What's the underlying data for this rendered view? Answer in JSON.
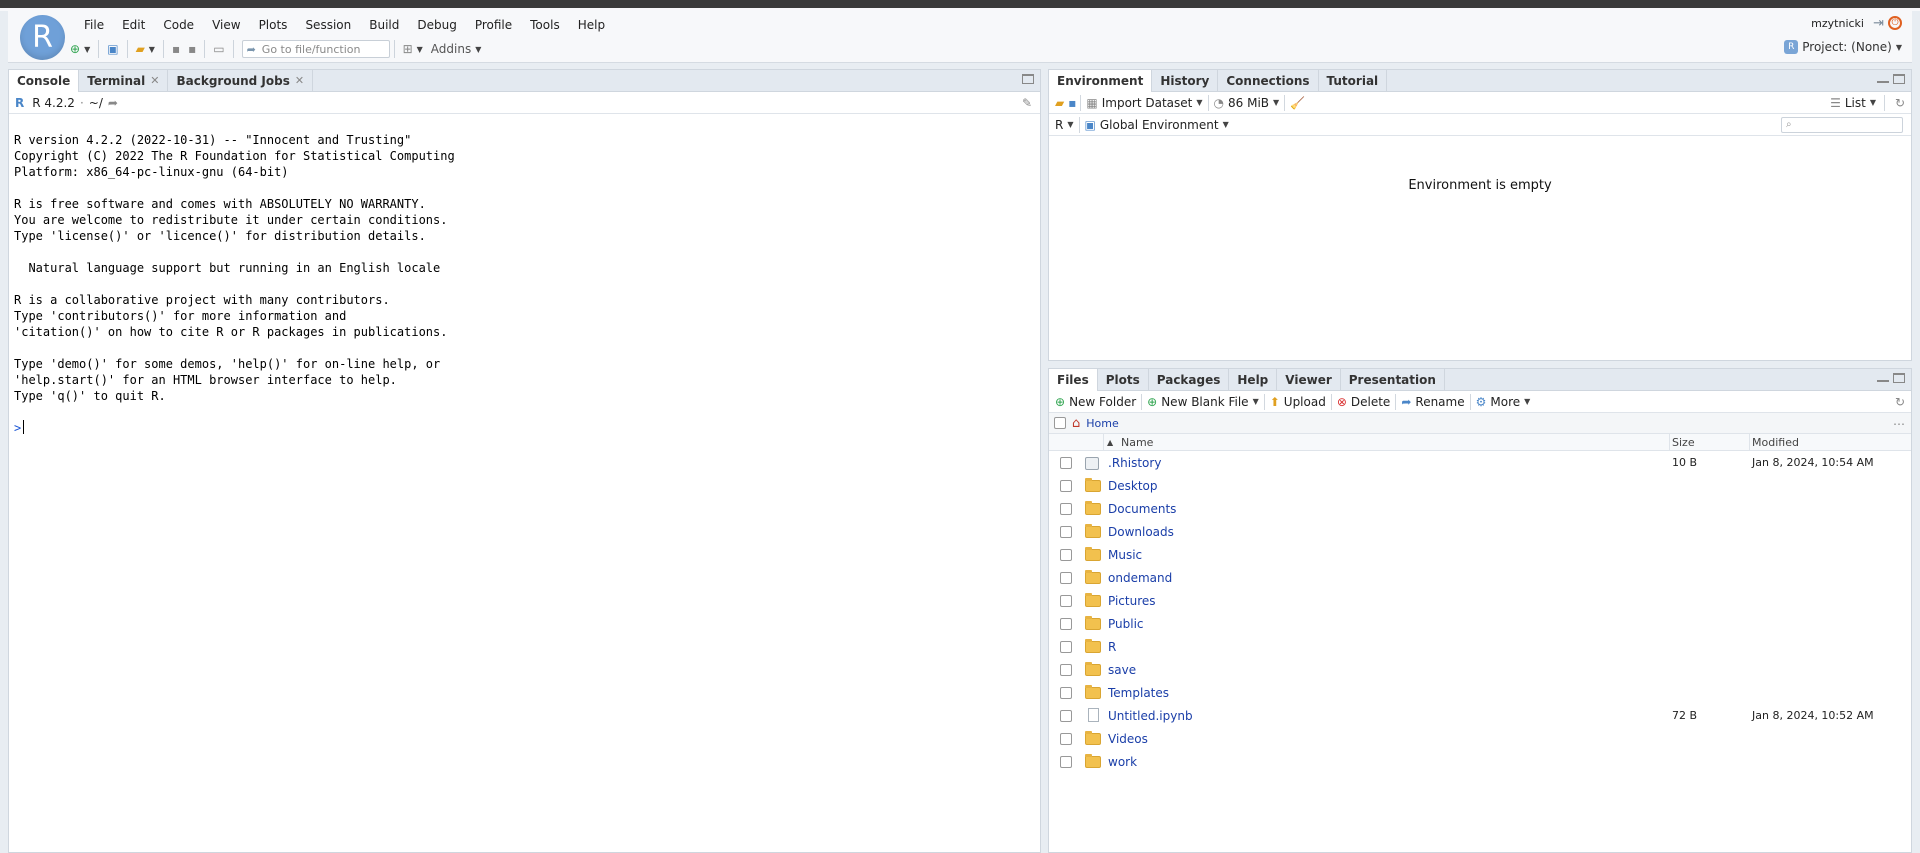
{
  "app": {
    "logo_letter": "R",
    "menus": [
      "File",
      "Edit",
      "Code",
      "View",
      "Plots",
      "Session",
      "Build",
      "Debug",
      "Profile",
      "Tools",
      "Help"
    ],
    "goto_placeholder": "Go to file/function",
    "addins_label": "Addins",
    "username": "mzytnicki",
    "project_label": "Project: (None)"
  },
  "console": {
    "tabs": [
      {
        "label": "Console",
        "closable": false
      },
      {
        "label": "Terminal",
        "closable": true
      },
      {
        "label": "Background Jobs",
        "closable": true
      }
    ],
    "version_label": "R 4.2.2",
    "path_label": "~/",
    "lines": [
      "R version 4.2.2 (2022-10-31) -- \"Innocent and Trusting\"",
      "Copyright (C) 2022 The R Foundation for Statistical Computing",
      "Platform: x86_64-pc-linux-gnu (64-bit)",
      "",
      "R is free software and comes with ABSOLUTELY NO WARRANTY.",
      "You are welcome to redistribute it under certain conditions.",
      "Type 'license()' or 'licence()' for distribution details.",
      "",
      "  Natural language support but running in an English locale",
      "",
      "R is a collaborative project with many contributors.",
      "Type 'contributors()' for more information and",
      "'citation()' on how to cite R or R packages in publications.",
      "",
      "Type 'demo()' for some demos, 'help()' for on-line help, or",
      "'help.start()' for an HTML browser interface to help.",
      "Type 'q()' to quit R.",
      ""
    ],
    "prompt": ">"
  },
  "environment": {
    "tabs": [
      "Environment",
      "History",
      "Connections",
      "Tutorial"
    ],
    "import_label": "Import Dataset",
    "memory_label": "86 MiB",
    "view_mode": "List",
    "language": "R",
    "scope": "Global Environment",
    "empty_message": "Environment is empty"
  },
  "files": {
    "tabs": [
      "Files",
      "Plots",
      "Packages",
      "Help",
      "Viewer",
      "Presentation"
    ],
    "actions": {
      "new_folder": "New Folder",
      "new_blank_file": "New Blank File",
      "upload": "Upload",
      "delete": "Delete",
      "rename": "Rename",
      "more": "More"
    },
    "breadcrumb": "Home",
    "columns": {
      "name": "Name",
      "size": "Size",
      "modified": "Modified"
    },
    "rows": [
      {
        "name": ".Rhistory",
        "type": "history",
        "size": "10 B",
        "modified": "Jan 8, 2024, 10:54 AM"
      },
      {
        "name": "Desktop",
        "type": "folder",
        "size": "",
        "modified": ""
      },
      {
        "name": "Documents",
        "type": "folder",
        "size": "",
        "modified": ""
      },
      {
        "name": "Downloads",
        "type": "folder",
        "size": "",
        "modified": ""
      },
      {
        "name": "Music",
        "type": "folder",
        "size": "",
        "modified": ""
      },
      {
        "name": "ondemand",
        "type": "folder",
        "size": "",
        "modified": ""
      },
      {
        "name": "Pictures",
        "type": "folder",
        "size": "",
        "modified": ""
      },
      {
        "name": "Public",
        "type": "folder-locked",
        "size": "",
        "modified": ""
      },
      {
        "name": "R",
        "type": "folder",
        "size": "",
        "modified": ""
      },
      {
        "name": "save",
        "type": "folder",
        "size": "",
        "modified": ""
      },
      {
        "name": "Templates",
        "type": "folder",
        "size": "",
        "modified": ""
      },
      {
        "name": "Untitled.ipynb",
        "type": "file",
        "size": "72 B",
        "modified": "Jan 8, 2024, 10:52 AM"
      },
      {
        "name": "Videos",
        "type": "folder",
        "size": "",
        "modified": ""
      },
      {
        "name": "work",
        "type": "folder",
        "size": "",
        "modified": ""
      }
    ]
  }
}
